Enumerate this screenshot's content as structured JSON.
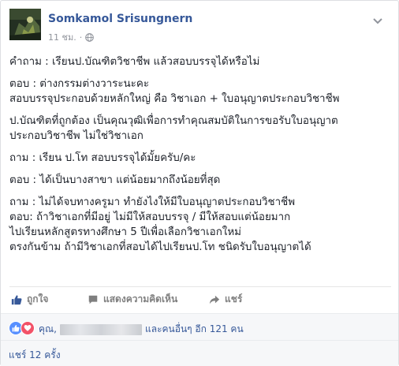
{
  "post": {
    "author": "Somkamol Srisungnern",
    "timestamp": "11 ชม.",
    "paragraphs": [
      [
        "คำถาม : เรียนป.บัณฑิตวิชาชีพ แล้วสอบบรรจุได้หรือไม่"
      ],
      [
        "ตอบ : ต่างกรรมต่างวาระนะคะ",
        "สอบบรรจุประกอบด้วยหลักใหญ่ คือ วิชาเอก + ใบอนุญาตประกอบวิชาชีพ"
      ],
      [
        "ป.บัณฑิตที่ถูกต้อง เป็นคุณวุฒิเพื่อการทำคุณสมบัติในการขอรับใบอนุญาต",
        "ประกอบวิชาชีพ ไม่ใช่วิชาเอก"
      ],
      [
        "ถาม : เรียน ป.โท สอบบรรจุได้มั้ยครับ/คะ"
      ],
      [
        "ตอบ : ได้เป็นบางสาขา แต่น้อยมากถึงน้อยที่สุด"
      ],
      [
        "ถาม : ไม่ได้จบทางครูมา ทำยังไงให้มีใบอนุญาตประกอบวิชาชีพ",
        "ตอบ: ถ้าวิชาเอกที่มีอยู่ ไม่มีให้สอบบรรจุ / มีให้สอบแต่น้อยมาก",
        "ไปเรียนหลักสูตรทางศึกษา 5 ปีเพื่อเลือกวิชาเอกใหม่",
        "ตรงกันข้าม ถ้ามีวิชาเอกที่สอบได้ไปเรียนป.โท ชนิดรับใบอนุญาตได้"
      ]
    ]
  },
  "actions": {
    "like": "ถูกใจ",
    "comment": "แสดงความคิดเห็น",
    "share": "แชร์"
  },
  "reactions": {
    "prefix": "คุณ,",
    "suffix": "และคนอื่นๆ อีก 121 คน"
  },
  "shares": {
    "label": "แชร์ 12 ครั้ง"
  },
  "colors": {
    "link": "#365899",
    "muted": "#90949c",
    "action": "#7f7f7f",
    "like_blue": "#5890ff",
    "love_red": "#f25268"
  },
  "icons": [
    "globe-icon",
    "chevron-down-icon",
    "like-icon",
    "comment-icon",
    "share-icon",
    "like-reaction-icon",
    "love-reaction-icon"
  ]
}
